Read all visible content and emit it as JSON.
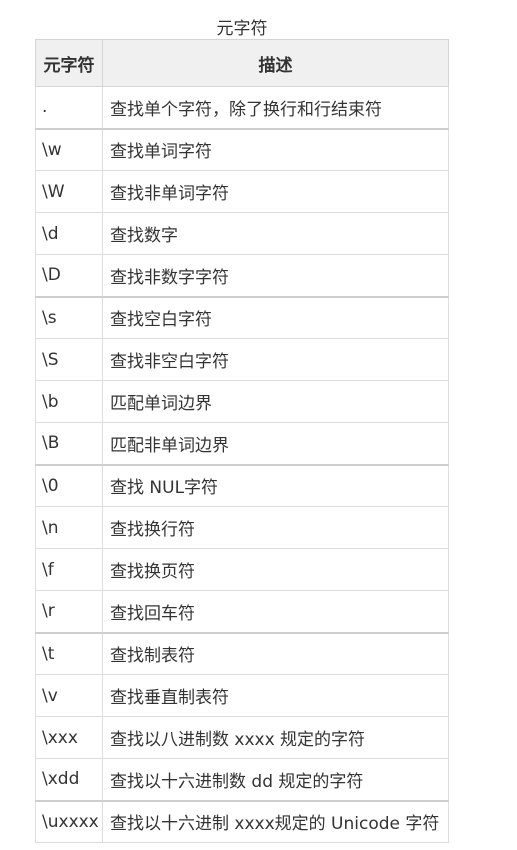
{
  "caption": "元字符",
  "table": {
    "headers": [
      "元字符",
      "描述"
    ],
    "rows": [
      {
        "symbol": ".",
        "description": "查找单个字符，除了换行和行结束符"
      },
      {
        "symbol": "\\w",
        "description": "查找单词字符"
      },
      {
        "symbol": "\\W",
        "description": "查找非单词字符"
      },
      {
        "symbol": "\\d",
        "description": "查找数字"
      },
      {
        "symbol": "\\D",
        "description": "查找非数字字符"
      },
      {
        "symbol": "\\s",
        "description": "查找空白字符"
      },
      {
        "symbol": "\\S",
        "description": "查找非空白字符"
      },
      {
        "symbol": "\\b",
        "description": "匹配单词边界"
      },
      {
        "symbol": "\\B",
        "description": "匹配非单词边界"
      },
      {
        "symbol": "\\0",
        "description": "查找 NUL字符"
      },
      {
        "symbol": "\\n",
        "description": "查找换行符"
      },
      {
        "symbol": "\\f",
        "description": "查找换页符"
      },
      {
        "symbol": "\\r",
        "description": "查找回车符"
      },
      {
        "symbol": "\\t",
        "description": "查找制表符"
      },
      {
        "symbol": "\\v",
        "description": "查找垂直制表符"
      },
      {
        "symbol": "\\xxx",
        "description": "查找以八进制数 xxxx 规定的字符"
      },
      {
        "symbol": "\\xdd",
        "description": "查找以十六进制数 dd 规定的字符"
      },
      {
        "symbol": "\\uxxxx",
        "description": "查找以十六进制 xxxx规定的 Unicode 字符"
      }
    ]
  }
}
